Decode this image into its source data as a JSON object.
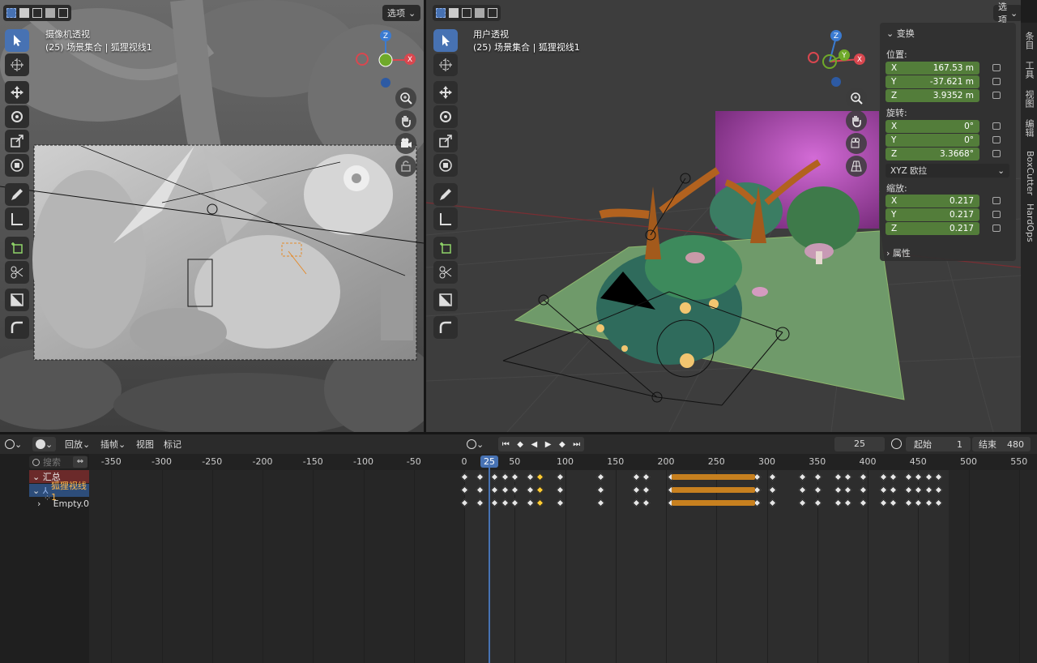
{
  "left_viewport": {
    "mode_label": "选项",
    "title": "摄像机透视",
    "subtitle": "(25) 场景集合 | 狐狸视线1",
    "gizmo": {
      "z": "Z",
      "x": "X"
    }
  },
  "right_viewport": {
    "mode_label": "选项",
    "title": "用户透视",
    "subtitle": "(25) 场景集合 | 狐狸视线1",
    "gizmo": {
      "z": "Z",
      "x": "X",
      "y": "Y"
    }
  },
  "npanel": {
    "transform_header": "变换",
    "location_label": "位置:",
    "location": [
      {
        "axis": "X",
        "value": "167.53 m"
      },
      {
        "axis": "Y",
        "value": "-37.621 m"
      },
      {
        "axis": "Z",
        "value": "3.9352 m"
      }
    ],
    "rotation_label": "旋转:",
    "rotation": [
      {
        "axis": "X",
        "value": "0°"
      },
      {
        "axis": "Y",
        "value": "0°"
      },
      {
        "axis": "Z",
        "value": "3.3668°"
      }
    ],
    "rotation_mode": "XYZ 欧拉",
    "scale_label": "缩放:",
    "scale": [
      {
        "axis": "X",
        "value": "0.217"
      },
      {
        "axis": "Y",
        "value": "0.217"
      },
      {
        "axis": "Z",
        "value": "0.217"
      }
    ],
    "properties_header": "属性",
    "tabs": [
      "条目",
      "工具",
      "视图",
      "编辑",
      "BoxCutter",
      "HardOps"
    ]
  },
  "timeline": {
    "menus": {
      "playback": "回放",
      "keying": "插帧",
      "view": "视图",
      "marker": "标记"
    },
    "current_frame": "25",
    "start_label": "起始",
    "start": "1",
    "end_label": "结束",
    "end": "480",
    "search_placeholder": "搜索",
    "ticks": [
      "-350",
      "-300",
      "-250",
      "-200",
      "-150",
      "-100",
      "-50",
      "0",
      "50",
      "100",
      "150",
      "200",
      "250",
      "300",
      "350",
      "400",
      "450",
      "500",
      "550"
    ],
    "playhead": "25",
    "channels": [
      {
        "label": "汇总",
        "color": "#6b2a2a"
      },
      {
        "label": "狐狸视线1",
        "color": "#2d4d7a"
      },
      {
        "label": "Empty.0",
        "color": ""
      }
    ]
  }
}
